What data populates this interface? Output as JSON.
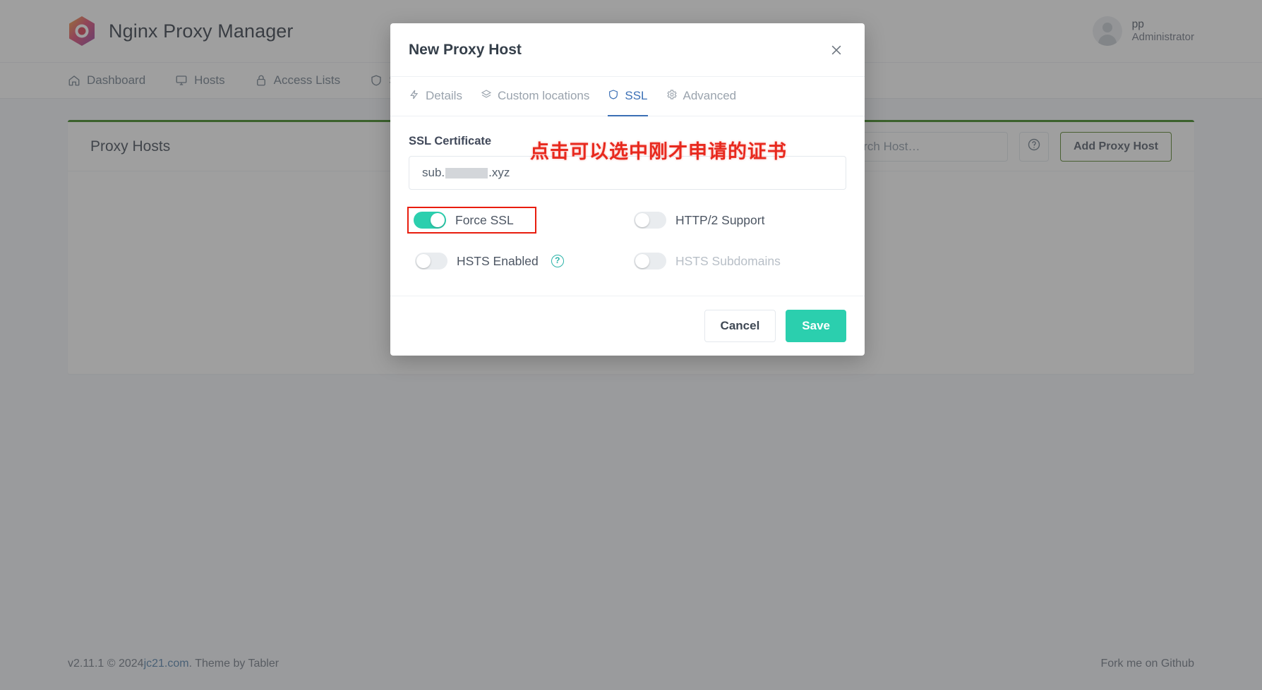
{
  "header": {
    "brand": "Nginx Proxy Manager",
    "logo_icon": "hexagon-logo-icon",
    "user_name": "pp",
    "user_role": "Administrator"
  },
  "nav": {
    "items": [
      {
        "label": "Dashboard",
        "icon": "home-icon"
      },
      {
        "label": "Hosts",
        "icon": "monitor-icon"
      },
      {
        "label": "Access Lists",
        "icon": "lock-icon"
      },
      {
        "label": "SSL Certificates",
        "icon": "shield-icon"
      }
    ]
  },
  "page": {
    "card_title": "Proxy Hosts",
    "search_placeholder": "Search Host…",
    "help_icon": "question-circle-icon",
    "add_button": "Add Proxy Host"
  },
  "footer": {
    "version": "v2.11.1 © 2024 ",
    "link": "jc21.com",
    "suffix": ". Theme by Tabler",
    "github": "Fork me on Github"
  },
  "modal": {
    "title": "New Proxy Host",
    "close_icon": "close-icon",
    "tabs": [
      {
        "label": "Details",
        "icon": "bolt-icon",
        "active": false
      },
      {
        "label": "Custom locations",
        "icon": "layers-icon",
        "active": false
      },
      {
        "label": "SSL",
        "icon": "shield-icon",
        "active": true
      },
      {
        "label": "Advanced",
        "icon": "gear-icon",
        "active": false
      }
    ],
    "ssl_certificate_label": "SSL Certificate",
    "ssl_certificate_value_prefix": "sub.",
    "ssl_certificate_value_suffix": ".xyz",
    "annotation_cn": "点击可以选中刚才申请的证书",
    "toggles": [
      {
        "label": "Force SSL",
        "on": true,
        "highlighted": true,
        "disabled": false,
        "help": false
      },
      {
        "label": "HTTP/2 Support",
        "on": false,
        "highlighted": false,
        "disabled": false,
        "help": false
      },
      {
        "label": "HSTS Enabled",
        "on": false,
        "highlighted": false,
        "disabled": false,
        "help": true
      },
      {
        "label": "HSTS Subdomains",
        "on": false,
        "highlighted": false,
        "disabled": true,
        "help": false
      }
    ],
    "cancel_label": "Cancel",
    "save_label": "Save"
  },
  "colors": {
    "accent_teal": "#2bcfae",
    "annotation_red": "#e8291e",
    "highlight_red": "#e81d0e",
    "card_top_green": "#2e7d0f",
    "tab_active_blue": "#3b6fb5"
  }
}
